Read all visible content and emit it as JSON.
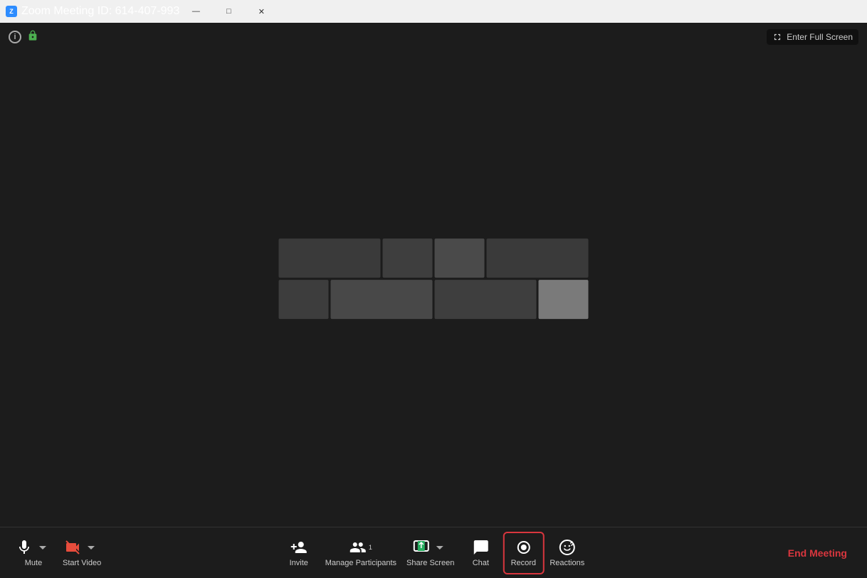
{
  "titlebar": {
    "title": "Zoom Meeting ID: 614-407-993",
    "minimize_label": "—",
    "maximize_label": "□",
    "close_label": "✕"
  },
  "topbar": {
    "fullscreen_label": "Enter Full Screen"
  },
  "toolbar": {
    "mute_label": "Mute",
    "start_video_label": "Start Video",
    "invite_label": "Invite",
    "manage_participants_label": "Manage Participants",
    "share_screen_label": "Share Screen",
    "chat_label": "Chat",
    "record_label": "Record",
    "reactions_label": "Reactions",
    "end_meeting_label": "End Meeting",
    "participants_count": "1"
  },
  "content_cells": [
    {
      "color": "#3a3a3a"
    },
    {
      "color": "#404040"
    },
    {
      "color": "#383838"
    },
    {
      "color": "#4a4a4a"
    },
    {
      "color": "#353535"
    },
    {
      "color": "#3d3d3d"
    },
    {
      "color": "#424242"
    },
    {
      "color": "#4d4d4d"
    },
    {
      "color": "#3c3c3c"
    },
    {
      "color": "#484848"
    },
    {
      "color": "#616161"
    },
    {
      "color": "#7a7a7a"
    }
  ]
}
